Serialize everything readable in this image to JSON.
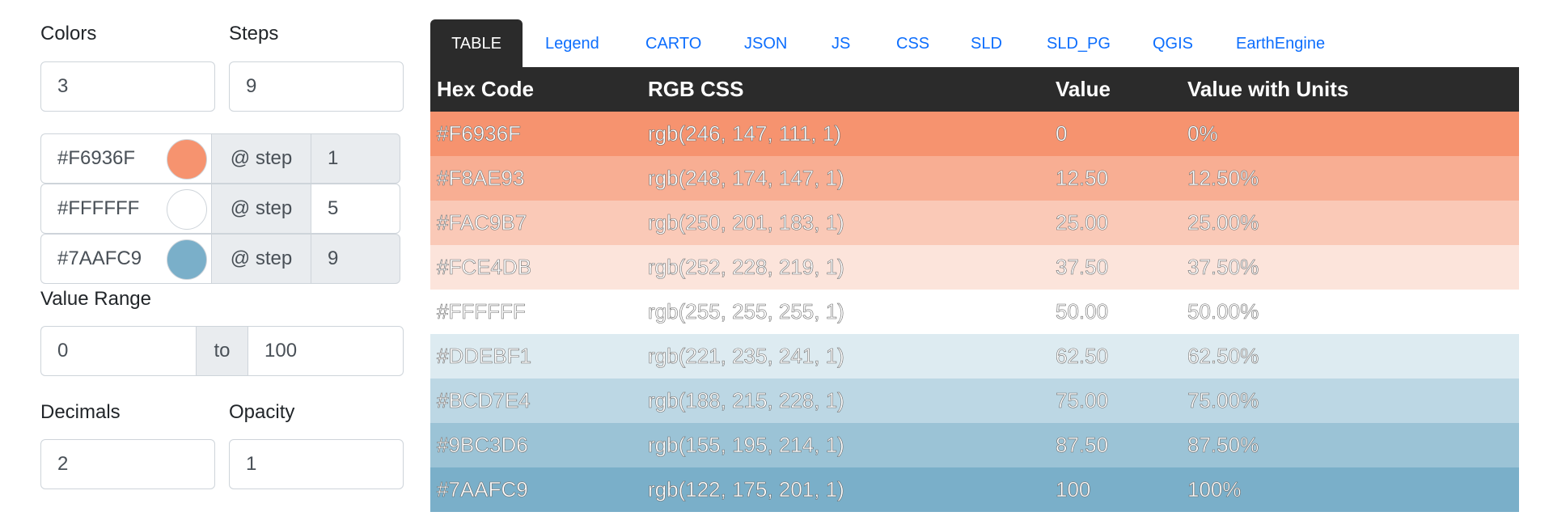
{
  "controls": {
    "colors_label": "Colors",
    "colors_value": "3",
    "steps_label": "Steps",
    "steps_value": "9",
    "stops": [
      {
        "hex": "#F6936F",
        "color": "#F6936F",
        "at_label": "@ step",
        "step": "1"
      },
      {
        "hex": "#FFFFFF",
        "color": "#FFFFFF",
        "at_label": "@ step",
        "step": "5"
      },
      {
        "hex": "#7AAFC9",
        "color": "#7AAFC9",
        "at_label": "@ step",
        "step": "9"
      }
    ],
    "value_range_label": "Value Range",
    "range_min": "0",
    "range_to": "to",
    "range_max": "100",
    "decimals_label": "Decimals",
    "decimals_value": "2",
    "opacity_label": "Opacity",
    "opacity_value": "1"
  },
  "tabs": [
    "TABLE",
    "Legend",
    "CARTO",
    "JSON",
    "JS",
    "CSS",
    "SLD",
    "SLD_PG",
    "QGIS",
    "EarthEngine"
  ],
  "active_tab": "TABLE",
  "table": {
    "headers": [
      "Hex Code",
      "RGB CSS",
      "Value",
      "Value with Units"
    ],
    "rows": [
      {
        "hex": "#F6936F",
        "rgb": "rgb(246, 147, 111, 1)",
        "value": "0",
        "units": "0%",
        "bg": "#F6936F"
      },
      {
        "hex": "#F8AE93",
        "rgb": "rgb(248, 174, 147, 1)",
        "value": "12.50",
        "units": "12.50%",
        "bg": "#F8AE93"
      },
      {
        "hex": "#FAC9B7",
        "rgb": "rgb(250, 201, 183, 1)",
        "value": "25.00",
        "units": "25.00%",
        "bg": "#FAC9B7"
      },
      {
        "hex": "#FCE4DB",
        "rgb": "rgb(252, 228, 219, 1)",
        "value": "37.50",
        "units": "37.50%",
        "bg": "#FCE4DB"
      },
      {
        "hex": "#FFFFFF",
        "rgb": "rgb(255, 255, 255, 1)",
        "value": "50.00",
        "units": "50.00%",
        "bg": "#FFFFFF"
      },
      {
        "hex": "#DDEBF1",
        "rgb": "rgb(221, 235, 241, 1)",
        "value": "62.50",
        "units": "62.50%",
        "bg": "#DDEBF1"
      },
      {
        "hex": "#BCD7E4",
        "rgb": "rgb(188, 215, 228, 1)",
        "value": "75.00",
        "units": "75.00%",
        "bg": "#BCD7E4"
      },
      {
        "hex": "#9BC3D6",
        "rgb": "rgb(155, 195, 214, 1)",
        "value": "87.50",
        "units": "87.50%",
        "bg": "#9BC3D6"
      },
      {
        "hex": "#7AAFC9",
        "rgb": "rgb(122, 175, 201, 1)",
        "value": "100",
        "units": "100%",
        "bg": "#7AAFC9"
      }
    ]
  }
}
